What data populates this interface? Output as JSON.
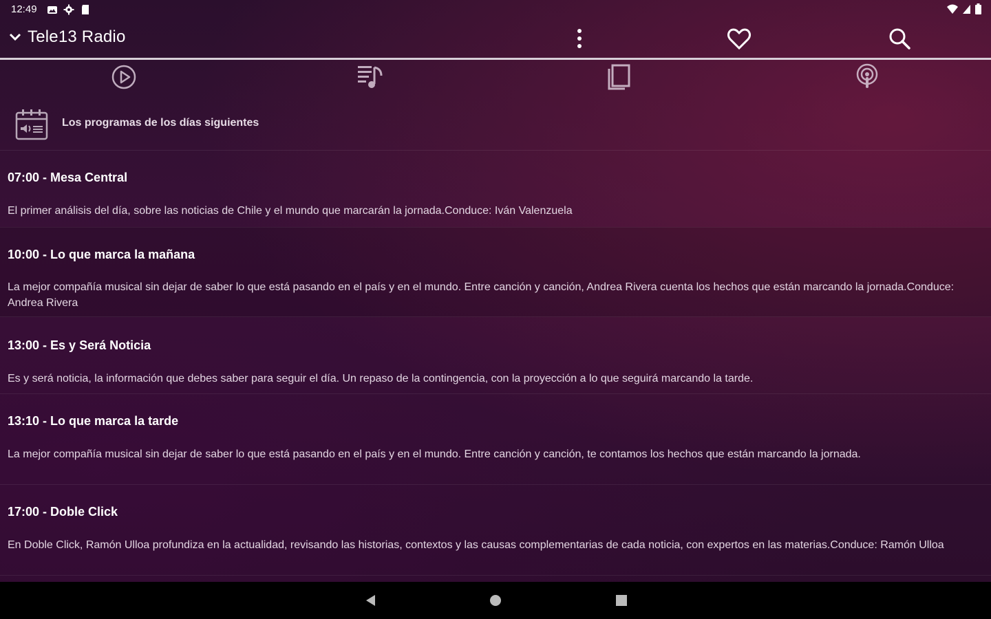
{
  "status_bar": {
    "time": "12:49",
    "left_icons": [
      "photo-icon",
      "settings-icon",
      "sd-card-icon"
    ],
    "right_icons": [
      "wifi-icon",
      "signal-icon",
      "battery-icon"
    ]
  },
  "app_bar": {
    "title": "Tele13 Radio",
    "icons": [
      "chevron-down-icon",
      "more-vert-icon",
      "heart-icon",
      "search-icon"
    ]
  },
  "tabs": [
    {
      "icon": "play-circle-icon"
    },
    {
      "icon": "playlist-music-icon"
    },
    {
      "icon": "program-guide-icon"
    },
    {
      "icon": "podcast-icon"
    }
  ],
  "schedule": {
    "header": "Los programas de los días siguientes",
    "header_icon": "calendar-icon",
    "programs": [
      {
        "title": "07:00 - Mesa Central",
        "description": "El primer análisis del día, sobre las noticias de Chile y el mundo que marcarán la jornada.Conduce: Iván Valenzuela"
      },
      {
        "title": "10:00 - Lo que marca la mañana",
        "description": "La mejor compañía musical sin dejar de saber lo que está pasando en el país y en el mundo. Entre canción y canción, Andrea Rivera cuenta los hechos que están marcando la jornada.Conduce: Andrea Rivera"
      },
      {
        "title": "13:00 - Es y Será Noticia",
        "description": "Es y será noticia, la información que debes saber para seguir el día. Un repaso de la contingencia, con la proyección a lo que seguirá marcando la tarde."
      },
      {
        "title": "13:10 - Lo que marca la tarde",
        "description": "La mejor compañía musical sin dejar de saber lo que está pasando en el país y en el mundo. Entre canción y canción, te contamos los hechos que están marcando la jornada."
      },
      {
        "title": "17:00 - Doble Click",
        "description": "En Doble Click, Ramón Ulloa profundiza en la actualidad, revisando las historias, contextos y las causas complementarias de cada noticia, con expertos en las materias.Conduce: Ramón Ulloa"
      }
    ]
  },
  "nav_bar": {
    "icons": [
      "back-icon",
      "home-icon",
      "recents-icon"
    ]
  },
  "colors": {
    "background": "#361234",
    "accent": "#d8cfd8",
    "nav_bar": "#000000"
  }
}
